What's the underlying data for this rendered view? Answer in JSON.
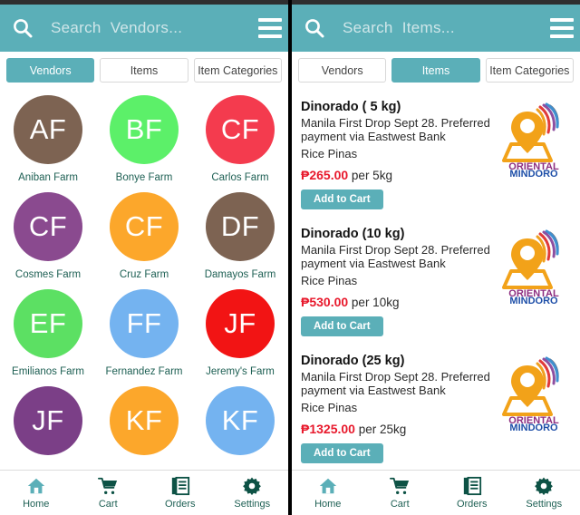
{
  "theme": {
    "accent": "#5bafb8",
    "price_color": "#e8192c",
    "label_color": "#1d5f53",
    "divider_color": "#000000"
  },
  "left_panel": {
    "search": {
      "placeholder": "Search  Vendors...",
      "value": "",
      "icon": "search-icon"
    },
    "menu_icon": "hamburger-menu-icon",
    "tabs": [
      {
        "label": "Vendors",
        "active": true
      },
      {
        "label": "Items",
        "active": false
      },
      {
        "label": "Item Categories",
        "active": false
      }
    ],
    "vendors": [
      {
        "initials": "AF",
        "name": "Aniban Farm",
        "color": "#7d6352"
      },
      {
        "initials": "BF",
        "name": "Bonye Farm",
        "color": "#5cf069"
      },
      {
        "initials": "CF",
        "name": "Carlos Farm",
        "color": "#f43b4e"
      },
      {
        "initials": "CF",
        "name": "Cosmes Farm",
        "color": "#8a4a8f"
      },
      {
        "initials": "CF",
        "name": "Cruz Farm",
        "color": "#fca72b"
      },
      {
        "initials": "DF",
        "name": "Damayos Farm",
        "color": "#7d6352"
      },
      {
        "initials": "EF",
        "name": "Emilianos Farm",
        "color": "#5ce063"
      },
      {
        "initials": "FF",
        "name": "Fernandez Farm",
        "color": "#74b3f0"
      },
      {
        "initials": "JF",
        "name": "Jeremy's Farm",
        "color": "#f21414"
      },
      {
        "initials": "JF",
        "name": "",
        "color": "#7b3f87"
      },
      {
        "initials": "KF",
        "name": "",
        "color": "#fca72b"
      },
      {
        "initials": "KF",
        "name": "",
        "color": "#74b3f0"
      }
    ]
  },
  "right_panel": {
    "search": {
      "placeholder": "Search  Items...",
      "value": "",
      "icon": "search-icon"
    },
    "menu_icon": "hamburger-menu-icon",
    "tabs": [
      {
        "label": "Vendors",
        "active": false
      },
      {
        "label": "Items",
        "active": true
      },
      {
        "label": "Item Categories",
        "active": false
      }
    ],
    "items": [
      {
        "title": "Dinorado ( 5 kg)",
        "description": "Manila First Drop Sept 28. Preferred payment via Eastwest Bank",
        "category": "Rice Pinas",
        "price": "₱265.00",
        "price_unit": "per 5kg",
        "button_label": "Add to Cart",
        "logo": {
          "name": "oriental-mindoro-logo",
          "line1": "ORIENTAL",
          "line2": "MINDORO"
        }
      },
      {
        "title": "Dinorado (10 kg)",
        "description": "Manila First Drop Sept 28. Preferred payment via Eastwest Bank",
        "category": "Rice Pinas",
        "price": "₱530.00",
        "price_unit": "per 10kg",
        "button_label": "Add to Cart",
        "logo": {
          "name": "oriental-mindoro-logo",
          "line1": "ORIENTAL",
          "line2": "MINDORO"
        }
      },
      {
        "title": "Dinorado (25 kg)",
        "description": "Manila First Drop Sept 28. Preferred payment via Eastwest Bank",
        "category": "Rice Pinas",
        "price": "₱1325.00",
        "price_unit": "per 25kg",
        "button_label": "Add to Cart",
        "logo": {
          "name": "oriental-mindoro-logo",
          "line1": "ORIENTAL",
          "line2": "MINDORO"
        }
      }
    ]
  },
  "bottom_nav": [
    {
      "label": "Home",
      "icon": "home-icon"
    },
    {
      "label": "Cart",
      "icon": "cart-icon"
    },
    {
      "label": "Orders",
      "icon": "orders-icon"
    },
    {
      "label": "Settings",
      "icon": "gear-icon"
    }
  ]
}
